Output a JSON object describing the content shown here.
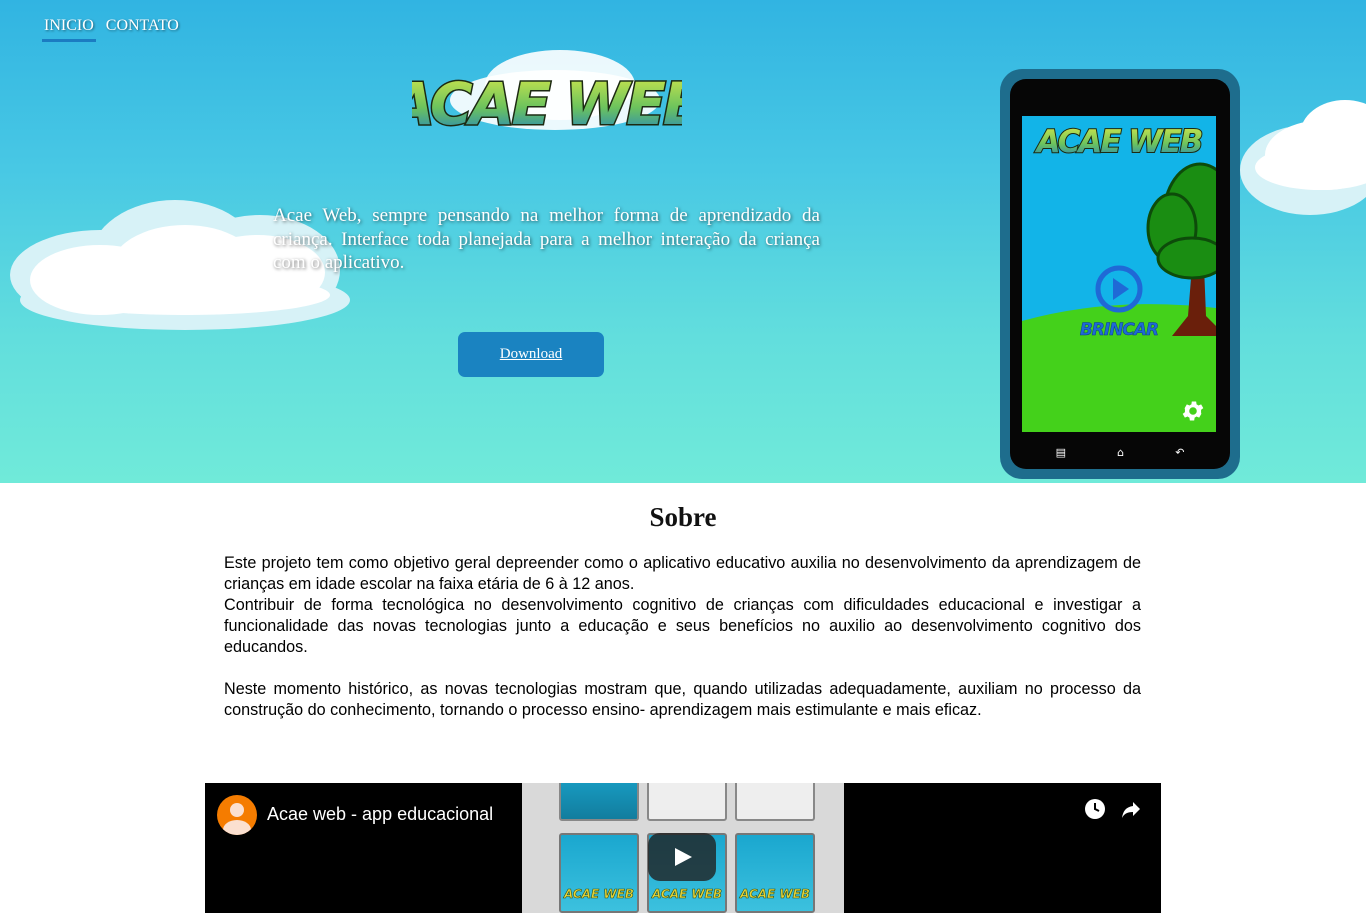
{
  "nav": {
    "items": [
      {
        "label": "INICIO",
        "active": true
      },
      {
        "label": "CONTATO",
        "active": false
      }
    ]
  },
  "hero": {
    "logo_text": "ACAE WEB",
    "description": "Acae Web, sempre pensando na melhor forma de aprendizado da criança. Interface toda planejada para a melhor interação da criança com o aplicativo.",
    "download_label": "Download",
    "button_color": "#1a83c1"
  },
  "phone": {
    "screen_logo": "ACAE WEB",
    "play_label": "BRINCAR",
    "settings_icon": "gear-icon",
    "softkeys": [
      "menu-icon",
      "home-icon",
      "back-icon"
    ]
  },
  "about": {
    "title": "Sobre",
    "paragraphs": [
      "Este projeto tem como objetivo geral depreender como o aplicativo educativo auxilia no desenvolvimento da aprendizagem de crianças em idade escolar na faixa etária de 6 à 12 anos.",
      "Contribuir de forma tecnológica no desenvolvimento cognitivo de crianças com dificuldades educacional e investigar a funcionalidade das novas tecnologias junto a educação e seus benefícios no auxilio ao desenvolvimento cognitivo dos educandos.",
      "Neste momento histórico, as novas tecnologias mostram que, quando utilizadas adequadamente, auxiliam no processo da construção do conhecimento, tornando o processo ensino- aprendizagem mais estimulante e mais eficaz."
    ]
  },
  "video": {
    "title": "Acae web - app educacional",
    "card_logo": "ACAE WEB",
    "icons": [
      "watch-later-icon",
      "share-icon",
      "play-icon"
    ]
  },
  "colors": {
    "sky_top": "#31b4e2",
    "sky_bottom": "#70ead9",
    "phone_frame": "#1e6d8d",
    "grass": "#44d11b",
    "tree": "#1a8d12"
  }
}
